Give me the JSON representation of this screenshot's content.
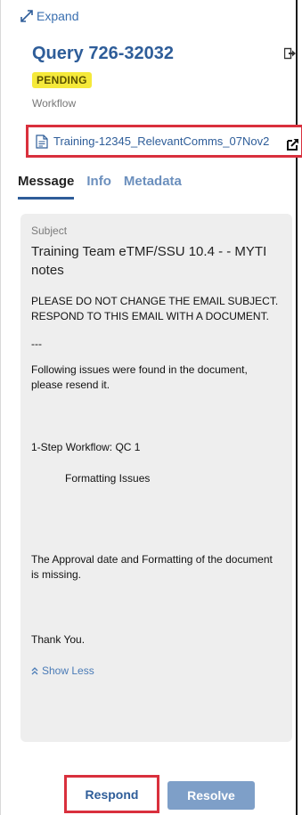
{
  "header": {
    "expand_label": "Expand",
    "query_title": "Query 726-32032",
    "status_badge": "PENDING",
    "workflow_label": "Workflow",
    "document_link": "Training-12345_RelevantComms_07Nov2"
  },
  "tabs": [
    {
      "label": "Message",
      "active": true
    },
    {
      "label": "Info",
      "active": false
    },
    {
      "label": "Metadata",
      "active": false
    }
  ],
  "message": {
    "subject_label": "Subject",
    "subject_value": "Training Team eTMF/SSU 10.4 - - MYTI notes",
    "line1": "PLEASE DO NOT CHANGE THE EMAIL SUBJECT. RESPOND TO THIS EMAIL WITH A DOCUMENT.",
    "line2": "---",
    "line3": "Following issues were found in the document, please resend it.",
    "line4": "1-Step Workflow: QC 1",
    "line5": "Formatting Issues",
    "line6": "The Approval date and Formatting of the document is missing.",
    "line7": "Thank You.",
    "show_less": "Show Less"
  },
  "actions": {
    "respond_label": "Respond",
    "resolve_label": "Resolve"
  },
  "colors": {
    "accent": "#2e5d99",
    "badge_bg": "#f5e93a",
    "highlight_border": "#d9303d",
    "resolve_bg": "#7e9fc8"
  },
  "icons": [
    "expand-icon",
    "exit-icon",
    "document-icon",
    "external-link-icon",
    "chevron-up-icon"
  ]
}
